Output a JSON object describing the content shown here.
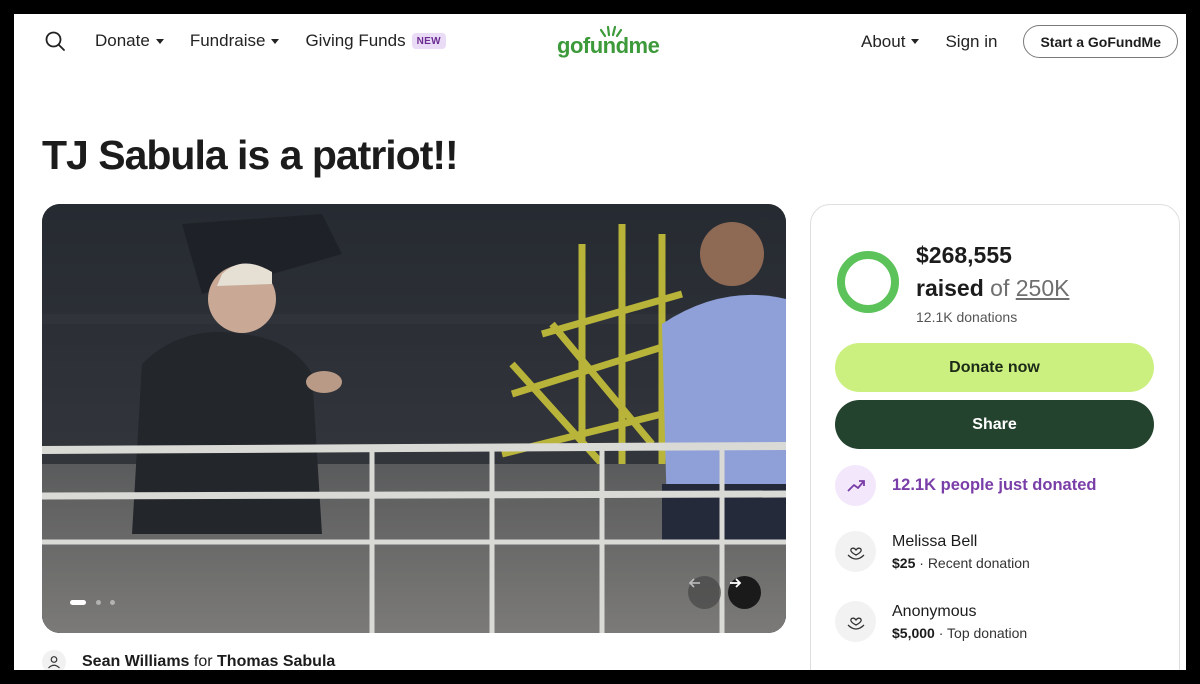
{
  "nav": {
    "donate": "Donate",
    "fundraise": "Fundraise",
    "giving_funds": "Giving Funds",
    "giving_funds_badge": "NEW",
    "logo": "gofundme",
    "about": "About",
    "sign_in": "Sign in",
    "start_button": "Start a GoFundMe"
  },
  "campaign": {
    "title": "TJ Sabula is a patriot!!",
    "organizer_name": "Sean Williams",
    "organizer_for": "for",
    "beneficiary": "Thomas Sabula",
    "media_slide_count": 3,
    "media_active_slide": 1
  },
  "progress": {
    "amount_raised": "$268,555",
    "raised_label": "raised",
    "of_label": "of",
    "goal": "250K",
    "donations_count": "12.1K donations",
    "fraction_of_goal": 1.0
  },
  "actions": {
    "donate_now": "Donate now",
    "share": "Share"
  },
  "activity": {
    "trend_text": "12.1K people just donated"
  },
  "donors": [
    {
      "name": "Melissa Bell",
      "amount": "$25",
      "separator": "·",
      "type": "Recent donation"
    },
    {
      "name": "Anonymous",
      "amount": "$5,000",
      "separator": "·",
      "type": "Top donation"
    }
  ],
  "colors": {
    "brand_green": "#3c9a3a",
    "donate_button": "#cbf07f",
    "share_button": "#23432e",
    "trend_purple": "#7a3ea8",
    "badge_bg": "#eadcf7"
  },
  "icons": {
    "search": "search-icon",
    "logo_sun": "logo-sun-icon",
    "arrow_prev": "arrow-left-icon",
    "arrow_next": "arrow-right-icon",
    "person": "person-icon",
    "trend": "trending-up-icon",
    "donor": "heart-hand-icon"
  }
}
